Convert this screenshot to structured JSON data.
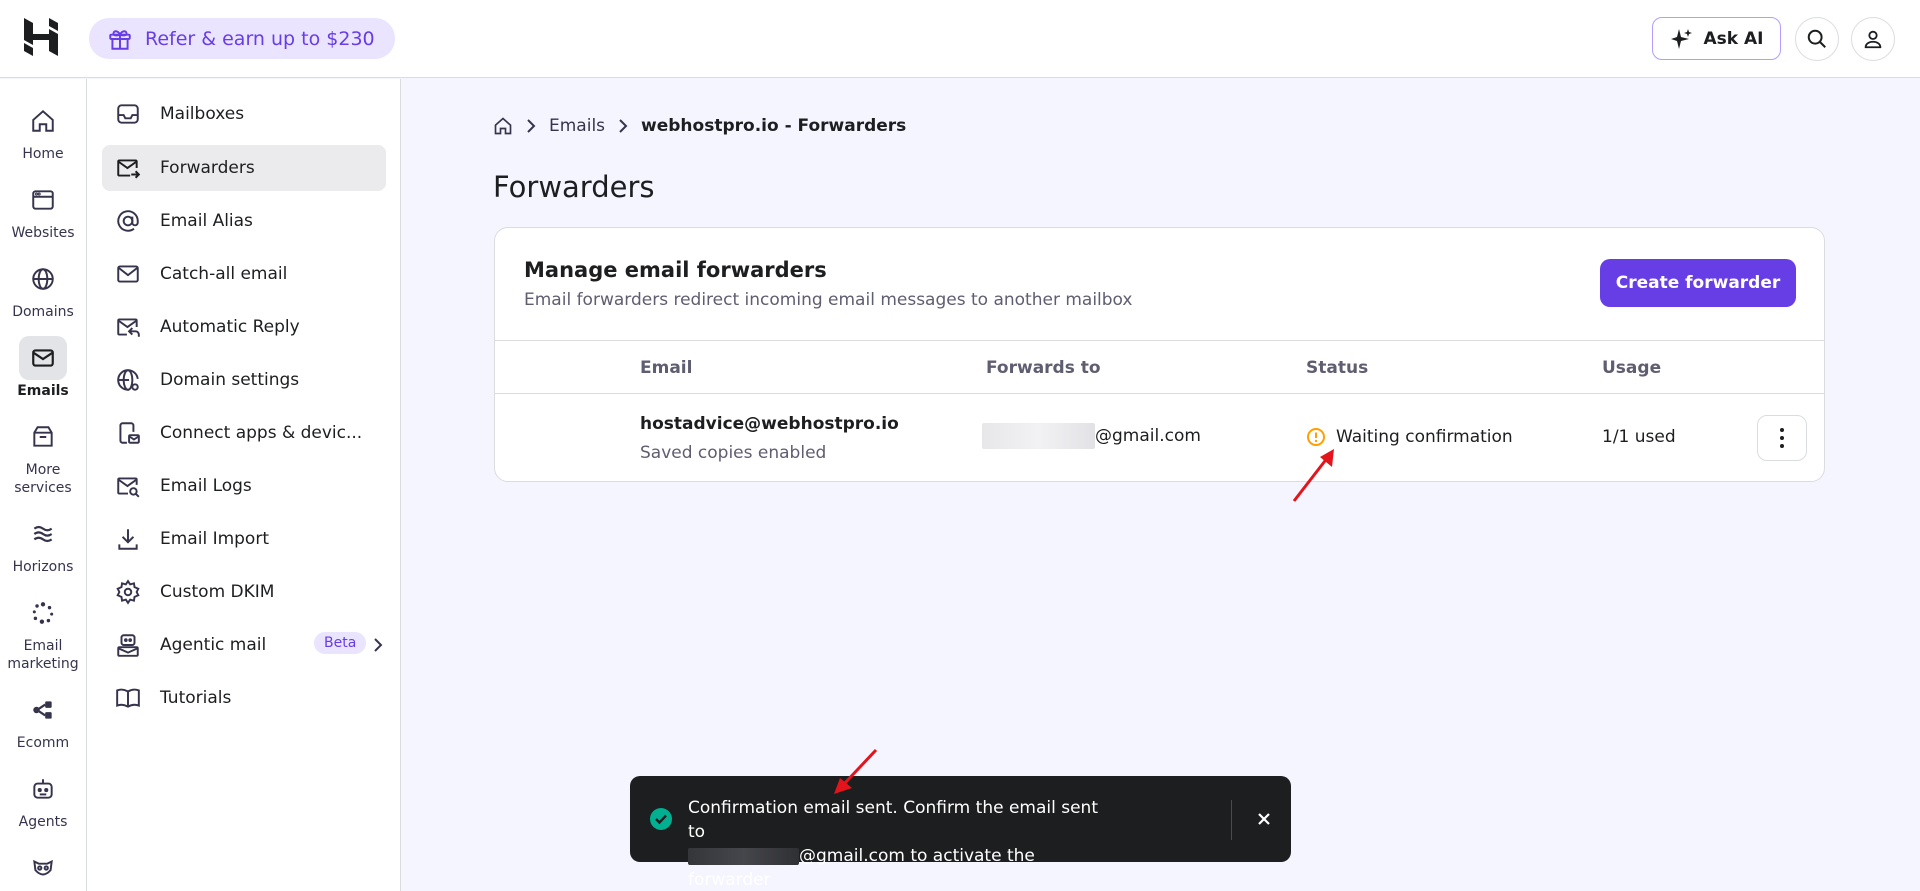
{
  "topbar": {
    "refer_label": "Refer & earn up to $230",
    "ask_ai_label": "Ask AI"
  },
  "rail": {
    "items": [
      {
        "label": "Home",
        "icon": "home-icon"
      },
      {
        "label": "Websites",
        "icon": "browser-icon"
      },
      {
        "label": "Domains",
        "icon": "globe-icon"
      },
      {
        "label": "Emails",
        "icon": "mail-icon",
        "active": true
      },
      {
        "label": "More services",
        "icon": "box-icon"
      },
      {
        "label": "Horizons",
        "icon": "horizons-icon"
      },
      {
        "label": "Email marketing",
        "icon": "email-marketing-icon"
      },
      {
        "label": "Ecomm",
        "icon": "ecomm-icon"
      },
      {
        "label": "Agents",
        "icon": "robot-icon"
      }
    ]
  },
  "sidebar": {
    "items": [
      {
        "label": "Mailboxes",
        "icon": "inbox-icon"
      },
      {
        "label": "Forwarders",
        "icon": "mail-forward-icon",
        "active": true
      },
      {
        "label": "Email Alias",
        "icon": "at-sign-icon"
      },
      {
        "label": "Catch-all email",
        "icon": "envelope-icon"
      },
      {
        "label": "Automatic Reply",
        "icon": "mail-reply-icon"
      },
      {
        "label": "Domain settings",
        "icon": "globe-settings-icon"
      },
      {
        "label": "Connect apps & devic...",
        "icon": "phone-mail-icon"
      },
      {
        "label": "Email Logs",
        "icon": "mail-search-icon"
      },
      {
        "label": "Email Import",
        "icon": "download-icon"
      },
      {
        "label": "Custom DKIM",
        "icon": "gear-icon"
      },
      {
        "label": "Agentic mail",
        "icon": "agent-mail-icon",
        "badge": "Beta"
      },
      {
        "label": "Tutorials",
        "icon": "book-icon"
      }
    ]
  },
  "breadcrumb": {
    "items": [
      "Emails"
    ],
    "current": "webhostpro.io - Forwarders"
  },
  "page": {
    "title": "Forwarders"
  },
  "card": {
    "title": "Manage email forwarders",
    "subtitle": "Email forwarders redirect incoming email messages to another mailbox",
    "create_button": "Create forwarder",
    "columns": [
      "Email",
      "Forwards to",
      "Status",
      "Usage"
    ],
    "rows": [
      {
        "email": "hostadvice@webhostpro.io",
        "email_sub": "Saved copies enabled",
        "forwards_to_suffix": "@gmail.com",
        "status": "Waiting confirmation",
        "usage": "1/1 used"
      }
    ]
  },
  "toast": {
    "line1": "Confirmation email sent. Confirm the email sent to",
    "line2_suffix": "@gmail.com to activate the forwarder"
  },
  "colors": {
    "brand": "#673de6",
    "warning": "#ffa000",
    "success": "#00b090",
    "annotation_arrow": "#e3141b"
  }
}
